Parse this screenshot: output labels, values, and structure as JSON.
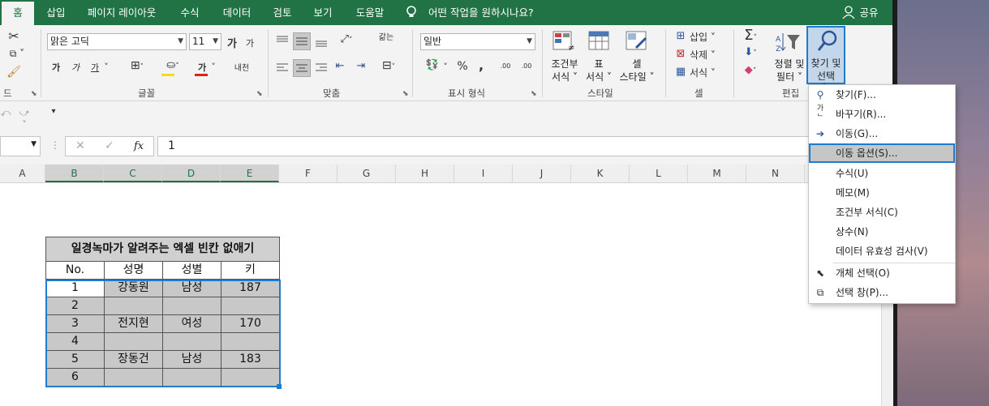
{
  "menubar": {
    "tabs": [
      "홈",
      "삽입",
      "페이지 레이아웃",
      "수식",
      "데이터",
      "검토",
      "보기",
      "도움말"
    ],
    "active": "홈",
    "tellme": "어떤 작업을 원하시나요?",
    "share": "공유"
  },
  "ribbon": {
    "clipboard_label": "드",
    "font_group_label": "글꼴",
    "font_name": "맑은 고딕",
    "font_size": "11",
    "font_grow": "가",
    "font_shrink": "가",
    "bold": "가",
    "italic": "가",
    "underline": "가",
    "font_color": "가",
    "phonetic": "내천",
    "align_group_label": "맞춤",
    "wrap": "갊는",
    "number_group_label": "표시 형식",
    "number_format": "일반",
    "percent": "%",
    "comma": ",",
    "dec_inc": ".00",
    "dec_dec": ".00",
    "style_group_label": "스타일",
    "cond_format": [
      "조건부",
      "서식"
    ],
    "table_format": [
      "표",
      "서식"
    ],
    "cell_style": [
      "셀",
      "스타일"
    ],
    "cells_group_label": "셀",
    "insert": "삽입",
    "delete": "삭제",
    "format": "서식",
    "edit_group_label": "편집",
    "sort_filter": [
      "정렬 및",
      "필터"
    ],
    "find_select": [
      "찾기 및",
      "선택"
    ]
  },
  "formula_bar": {
    "value": "1",
    "fx": "fx"
  },
  "columns": [
    "A",
    "B",
    "C",
    "D",
    "E",
    "F",
    "G",
    "H",
    "I",
    "J",
    "K",
    "L",
    "M",
    "N"
  ],
  "table": {
    "title": "일경녹마가 알려주는 엑셀 빈칸 없애기",
    "headers": [
      "No.",
      "성명",
      "성별",
      "키"
    ],
    "rows": [
      [
        "1",
        "강동원",
        "남성",
        "187"
      ],
      [
        "2",
        "",
        "",
        ""
      ],
      [
        "3",
        "전지현",
        "여성",
        "170"
      ],
      [
        "4",
        "",
        "",
        ""
      ],
      [
        "5",
        "장동건",
        "남성",
        "183"
      ],
      [
        "6",
        "",
        "",
        ""
      ]
    ]
  },
  "dropdown": {
    "items": [
      {
        "label": "찾기(F)...",
        "icon": "search-icon"
      },
      {
        "label": "바꾸기(R)...",
        "icon": "replace-icon"
      },
      {
        "label": "이동(G)...",
        "icon": "arrow-right-icon"
      },
      {
        "label": "이동 옵션(S)...",
        "icon": "",
        "highlighted": true
      },
      {
        "label": "수식(U)",
        "icon": ""
      },
      {
        "label": "메모(M)",
        "icon": ""
      },
      {
        "label": "조건부 서식(C)",
        "icon": ""
      },
      {
        "label": "상수(N)",
        "icon": ""
      },
      {
        "label": "데이터 유효성 검사(V)",
        "icon": ""
      },
      {
        "label": "개체 선택(O)",
        "icon": "cursor-icon"
      },
      {
        "label": "선택 창(P)...",
        "icon": "selection-pane-icon"
      }
    ]
  },
  "colors": {
    "excel_green": "#217346",
    "selection_blue": "#1f7bd0",
    "data_fill": "#c8c8c8"
  }
}
